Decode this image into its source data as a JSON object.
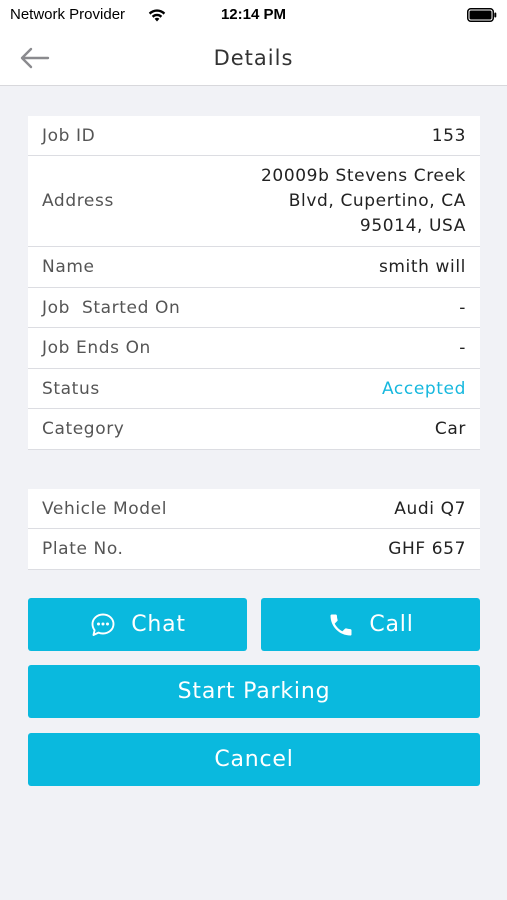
{
  "status_bar": {
    "carrier": "Network Provider",
    "time": "12:14 PM",
    "wifi_icon": "wifi-icon",
    "battery_icon": "battery-icon"
  },
  "header": {
    "back_icon": "back-arrow-icon",
    "title": "Details"
  },
  "details": {
    "rows": [
      {
        "label": "Job ID",
        "value": "153"
      },
      {
        "label": "Address",
        "value": "20009b Stevens Creek\nBlvd, Cupertino, CA\n95014, USA"
      },
      {
        "label": "Name",
        "value": "smith will"
      },
      {
        "label": "Job  Started On",
        "value": "-"
      },
      {
        "label": "Job Ends On",
        "value": "-"
      },
      {
        "label": "Status",
        "value": "Accepted"
      },
      {
        "label": "Category",
        "value": "Car"
      }
    ]
  },
  "vehicle": {
    "rows": [
      {
        "label": "Vehicle Model",
        "value": "Audi Q7"
      },
      {
        "label": "Plate No.",
        "value": "GHF 657"
      }
    ]
  },
  "actions": {
    "chat_label": "Chat",
    "chat_icon": "chat-bubble-icon",
    "call_label": "Call",
    "call_icon": "phone-icon",
    "start_parking_label": "Start Parking",
    "cancel_label": "Cancel"
  },
  "colors": {
    "accent": "#0ab9de",
    "status_accepted": "#17b8de",
    "background": "#f1f2f6"
  }
}
